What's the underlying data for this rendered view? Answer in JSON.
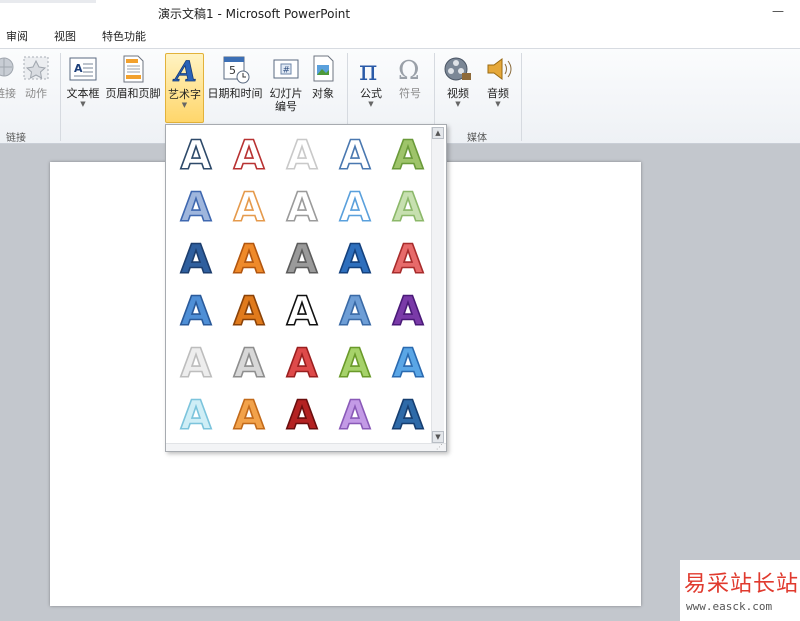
{
  "window": {
    "title": "演示文稿1 - Microsoft PowerPoint",
    "controls": "—"
  },
  "tabs": [
    {
      "label": "审阅"
    },
    {
      "label": "视图"
    },
    {
      "label": "特色功能"
    }
  ],
  "ribbon": {
    "groups": [
      {
        "label": "链接"
      },
      {
        "label": "媒体"
      }
    ],
    "buttons": {
      "hyperlink": {
        "label": "链接"
      },
      "action": {
        "label": "动作"
      },
      "textbox": {
        "label": "文本框"
      },
      "header_footer": {
        "label": "页眉和页脚"
      },
      "wordart": {
        "label": "艺术字"
      },
      "datetime": {
        "label": "日期和时间"
      },
      "slide_number": {
        "label": "幻灯片\n编号"
      },
      "object": {
        "label": "对象"
      },
      "equation": {
        "label": "公式"
      },
      "symbol": {
        "label": "符号"
      },
      "video": {
        "label": "视频"
      },
      "audio": {
        "label": "音频"
      }
    }
  },
  "wordart_gallery": {
    "glyph": "A",
    "styles": [
      [
        "#ffffff",
        "#2e4a6a"
      ],
      [
        "#ffffff",
        "#b83232"
      ],
      [
        "#ffffff",
        "#c9c9c9"
      ],
      [
        "#ffffff",
        "#4a78b0"
      ],
      [
        "#9ec46a",
        "#6a9a3a"
      ],
      [
        "#9fb6dd",
        "#3f68b0"
      ],
      [
        "#ffffff",
        "#e59a4c"
      ],
      [
        "#ffffff",
        "#9b9b9b"
      ],
      [
        "#ffffff",
        "#5aa0dc"
      ],
      [
        "#c7e0b0",
        "#8cb86a"
      ],
      [
        "#2f5f9e",
        "#1d3e6e"
      ],
      [
        "#ef8a2a",
        "#b2560f"
      ],
      [
        "#9a9a9a",
        "#5c5c5c"
      ],
      [
        "#2e6fbd",
        "#14417e"
      ],
      [
        "#e76a6a",
        "#a82c2c"
      ],
      [
        "#4f8fd6",
        "#2a5a9a"
      ],
      [
        "#e07a1c",
        "#8a4208"
      ],
      [
        "#ffffff",
        "#111111"
      ],
      [
        "#6e9ed6",
        "#3a6aa6"
      ],
      [
        "#7a3aa8",
        "#4a1a78"
      ],
      [
        "#ededed",
        "#bdbdbd"
      ],
      [
        "#d8d8d8",
        "#8e8e8e"
      ],
      [
        "#de4a4a",
        "#9a1f1f"
      ],
      [
        "#a6d26a",
        "#6a9a2a"
      ],
      [
        "#5aa6e6",
        "#2a6ab0"
      ],
      [
        "#cfeef6",
        "#7cc4dc"
      ],
      [
        "#f2a24a",
        "#c26a1a"
      ],
      [
        "#b42222",
        "#6a0e0e"
      ],
      [
        "#c39ae6",
        "#8a5ab8"
      ],
      [
        "#2e6aa8",
        "#163e70"
      ]
    ]
  },
  "watermark": {
    "name": "易采站长站",
    "url": "www.easck.com"
  }
}
